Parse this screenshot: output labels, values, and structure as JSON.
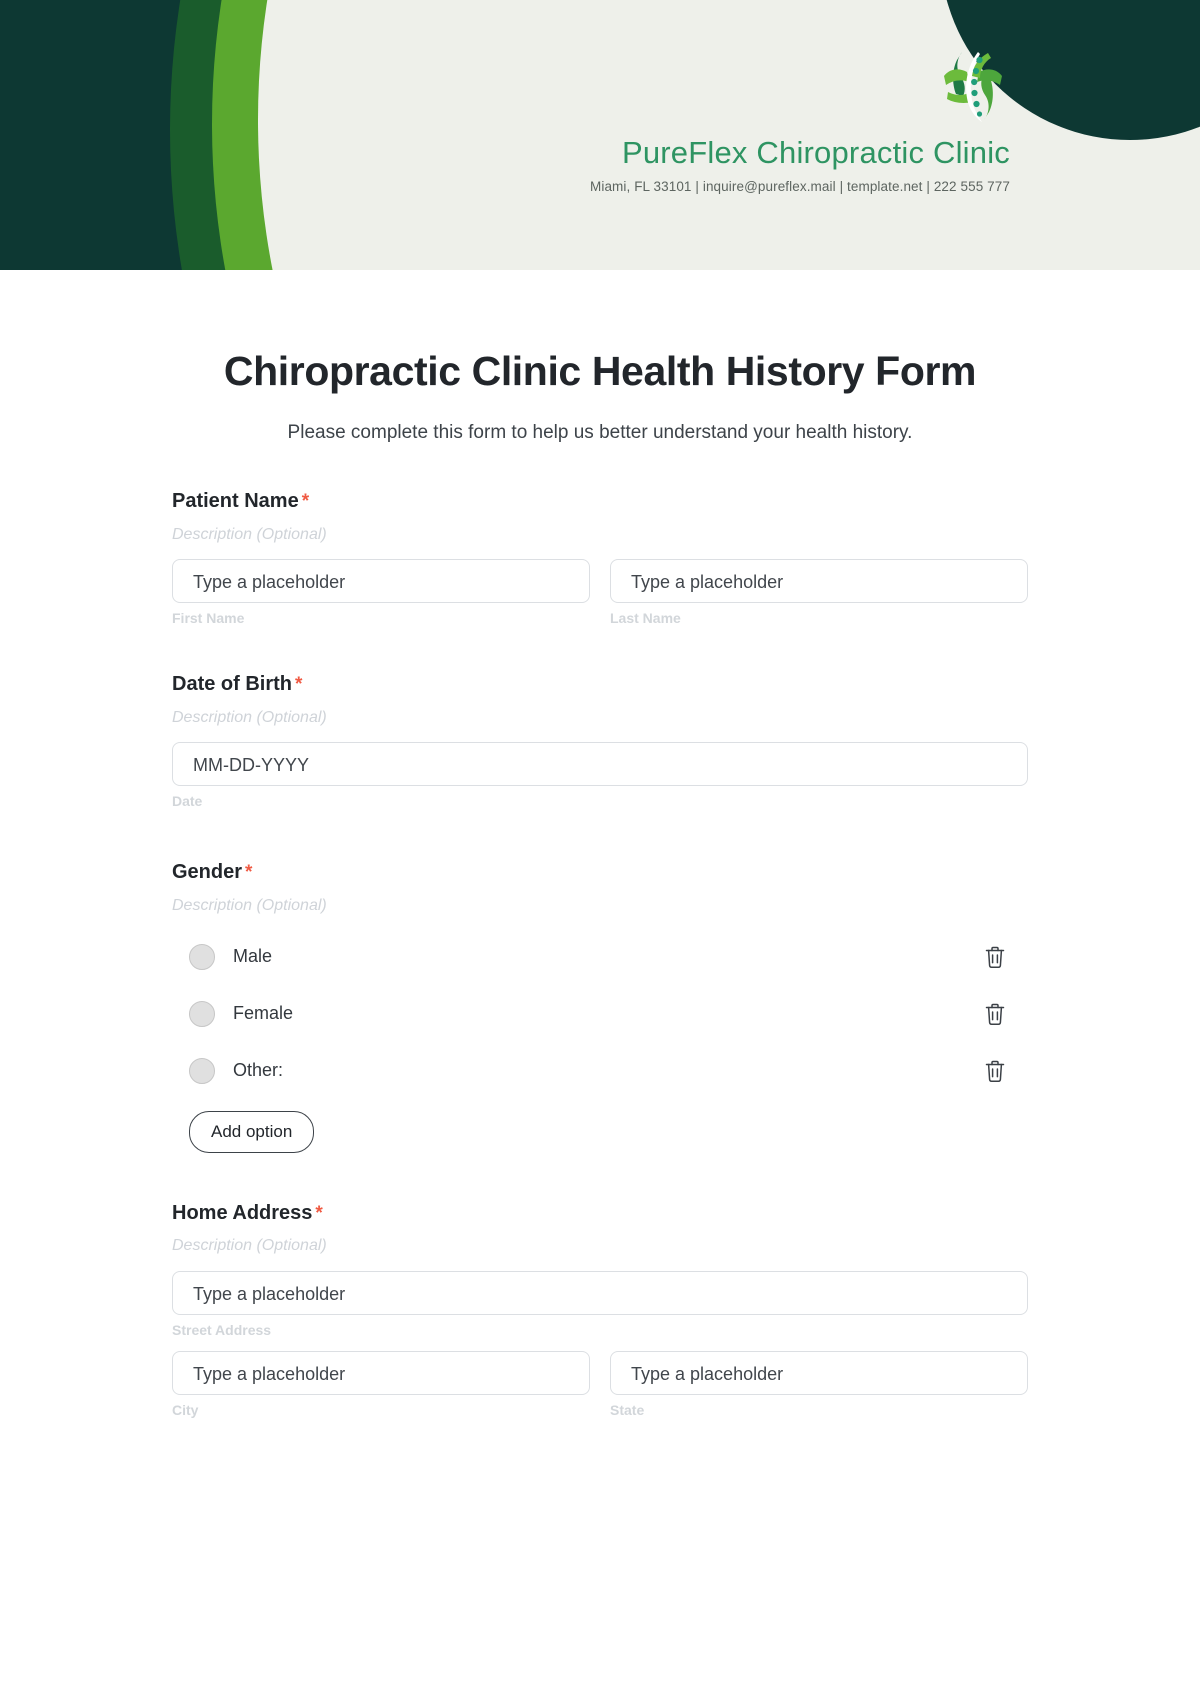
{
  "header": {
    "clinic_name": "PureFlex Chiropractic Clinic",
    "contact_line": "Miami, FL 33101 | inquire@pureflex.mail | template.net | 222 555 777",
    "colors": {
      "background": "#0d3833",
      "cream": "#eef0ea",
      "green_dark": "#1a5c2c",
      "green_light": "#5ba82f",
      "name_green": "#2e9462",
      "contact_gray": "#5d6560"
    }
  },
  "form": {
    "title": "Chiropractic Clinic Health History Form",
    "subtitle": "Please complete this form to help us better understand your health history.",
    "required_marker": "*",
    "description_placeholder": "Description (Optional)",
    "text_placeholder": "Type a placeholder",
    "date_placeholder": "MM-DD-YYYY",
    "add_option_label": "Add option",
    "fields": [
      {
        "label": "Patient Name",
        "required": true,
        "description": "Description (Optional)",
        "inputs": [
          {
            "placeholder": "Type a placeholder",
            "sub_label": "First Name"
          },
          {
            "placeholder": "Type a placeholder",
            "sub_label": "Last Name"
          }
        ]
      },
      {
        "label": "Date of Birth",
        "required": true,
        "description": "Description (Optional)",
        "inputs": [
          {
            "placeholder": "MM-DD-YYYY",
            "sub_label": "Date"
          }
        ]
      },
      {
        "label": "Gender",
        "required": true,
        "description": "Description (Optional)",
        "options": [
          {
            "label": "Male"
          },
          {
            "label": "Female"
          },
          {
            "label": "Other:"
          }
        ],
        "add_option_label": "Add option"
      },
      {
        "label": "Home Address",
        "required": true,
        "description": "Description (Optional)",
        "inputs": [
          {
            "placeholder": "Type a placeholder",
            "sub_label": "Street Address"
          }
        ],
        "inputs_row2": [
          {
            "placeholder": "Type a placeholder",
            "sub_label": "City"
          },
          {
            "placeholder": "Type a placeholder",
            "sub_label": "State"
          }
        ]
      }
    ]
  },
  "icons": {
    "logo": "spine-leaf-logo-icon",
    "delete": "trash-icon",
    "radio": "radio-button-icon"
  }
}
